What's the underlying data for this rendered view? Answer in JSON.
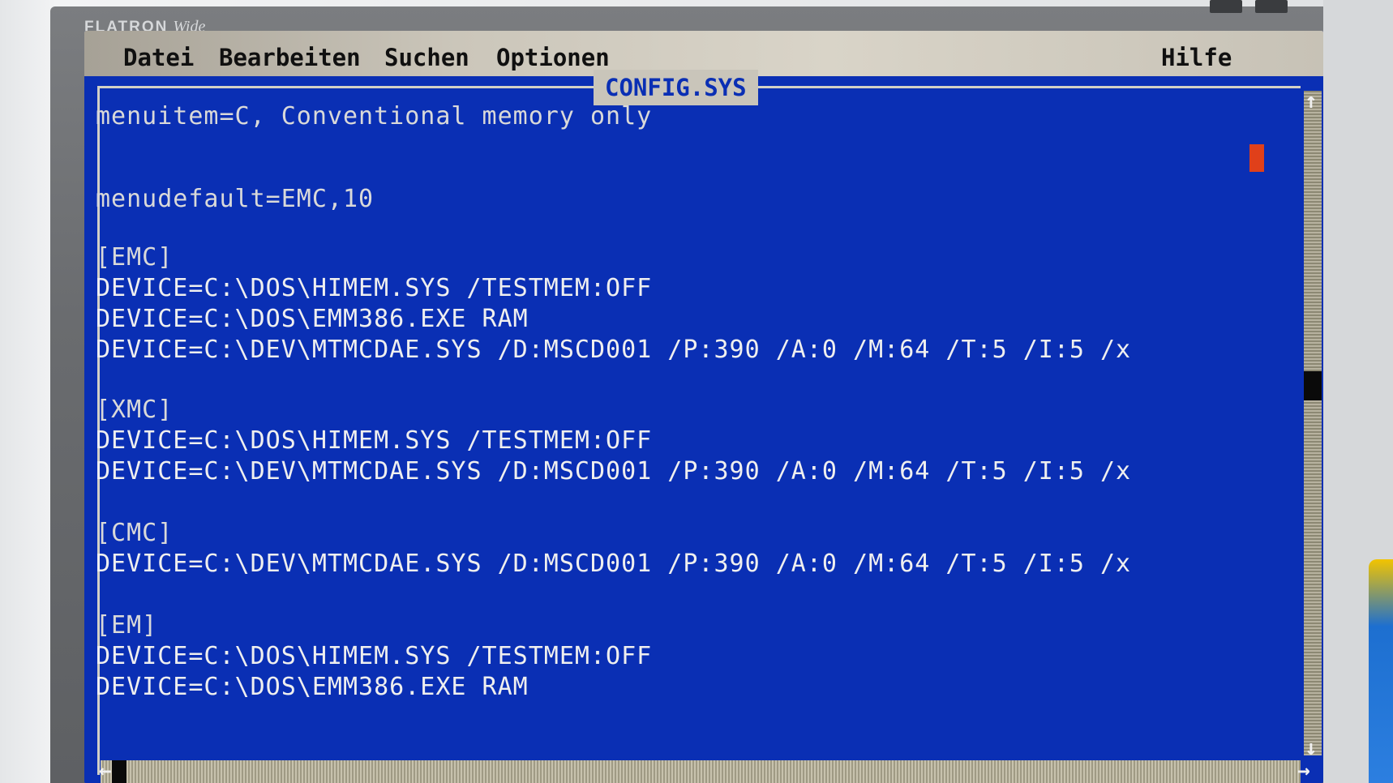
{
  "monitor": {
    "brand": "FLATRON",
    "brand_sub": "Wide"
  },
  "menubar": {
    "items": [
      "Datei",
      "Bearbeiten",
      "Suchen",
      "Optionen"
    ],
    "help": "Hilfe"
  },
  "window": {
    "title": "CONFIG.SYS"
  },
  "editor": {
    "lines": [
      "menuitem=C, Conventional memory only",
      "",
      "",
      "menudefault=EMC,10",
      "",
      "[EMC]",
      "DEVICE=C:\\DOS\\HIMEM.SYS /TESTMEM:OFF",
      "DEVICE=C:\\DOS\\EMM386.EXE RAM",
      "DEVICE=C:\\DEV\\MTMCDAE.SYS /D:MSCD001 /P:390 /A:0 /M:64 /T:5 /I:5 /x",
      "",
      "[XMC]",
      "DEVICE=C:\\DOS\\HIMEM.SYS /TESTMEM:OFF",
      "DEVICE=C:\\DEV\\MTMCDAE.SYS /D:MSCD001 /P:390 /A:0 /M:64 /T:5 /I:5 /x",
      "",
      "[CMC]",
      "DEVICE=C:\\DEV\\MTMCDAE.SYS /D:MSCD001 /P:390 /A:0 /M:64 /T:5 /I:5 /x",
      "",
      "[EM]",
      "DEVICE=C:\\DOS\\HIMEM.SYS /TESTMEM:OFF",
      "DEVICE=C:\\DOS\\EMM386.EXE RAM"
    ]
  },
  "scrollbars": {
    "up_arrow": "↑",
    "down_arrow": "↓",
    "left_arrow": "←",
    "right_arrow": "→"
  },
  "colors": {
    "editor_background": "#0a2fb4",
    "menubar_background": "#cbc6ba",
    "text": "#d9d9d9",
    "cursor": "#e0401a"
  }
}
